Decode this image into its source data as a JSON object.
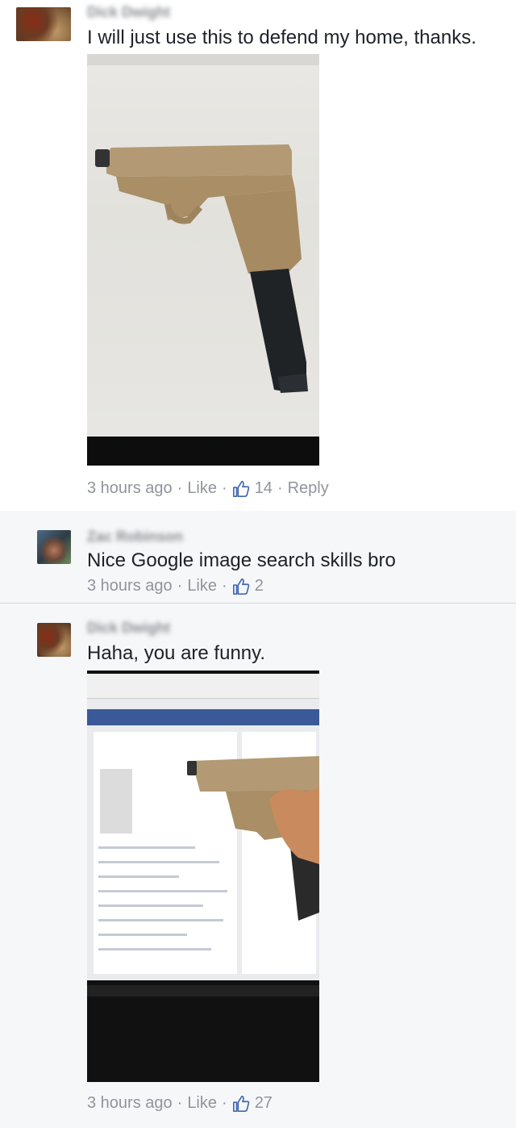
{
  "comments": [
    {
      "author": "Dick Dwight",
      "text": "I will just use this to defend my home, thanks.",
      "time": "3 hours ago",
      "like_label": "Like",
      "like_count": "14",
      "reply_label": "Reply"
    },
    {
      "author": "Zac Robinson",
      "text": "Nice Google image search skills bro",
      "time": "3 hours ago",
      "like_label": "Like",
      "like_count": "2"
    },
    {
      "author": "Dick Dwight",
      "text": "Haha, you are funny.",
      "time": "3 hours ago",
      "like_label": "Like",
      "like_count": "27"
    }
  ],
  "separator": "·",
  "icons": {
    "thumbs_up": "thumbs-up-icon"
  }
}
